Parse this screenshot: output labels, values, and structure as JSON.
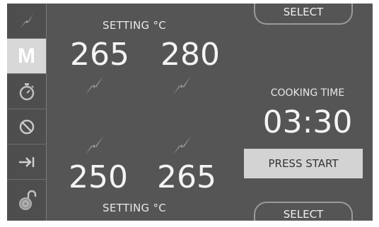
{
  "sidebar": {
    "items": [
      {
        "name": "heat-mode",
        "icon": "lightning-icon"
      },
      {
        "name": "manual-mode",
        "label": "M",
        "icon": "manual-icon"
      },
      {
        "name": "timer",
        "icon": "stopwatch-icon"
      },
      {
        "name": "cancel",
        "icon": "prohibited-icon"
      },
      {
        "name": "next",
        "icon": "arrow-right-bar-icon"
      },
      {
        "name": "unlock",
        "icon": "padlock-open-icon"
      }
    ]
  },
  "zones": {
    "setting_label_top": "SETTING °C",
    "setting_label_bottom": "SETTING °C",
    "top_left": "265",
    "top_right": "280",
    "bottom_left": "250",
    "bottom_right": "265"
  },
  "controls": {
    "select_top": "SELECT",
    "select_bottom": "SELECT",
    "cooking_time_label": "COOKING TIME",
    "cooking_time": "03:30",
    "press_start": "PRESS START"
  },
  "colors": {
    "background": "#555555",
    "text": "#f4f4f4",
    "active_tab": "#d8d8d8",
    "start_button": "#d3d3d3"
  }
}
